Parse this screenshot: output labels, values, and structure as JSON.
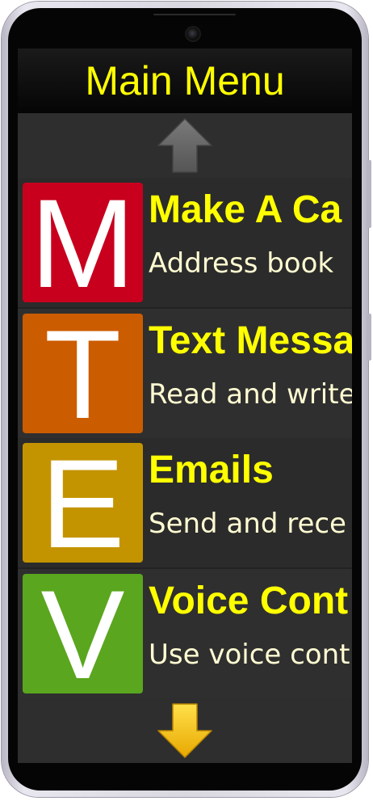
{
  "header": {
    "title": "Main Menu"
  },
  "navigation": {
    "up_icon": "arrow-up-icon",
    "down_icon": "arrow-down-icon",
    "up_color": "#666666",
    "down_color": "#f5c400"
  },
  "menu": {
    "items": [
      {
        "letter": "M",
        "title": "Make A Ca",
        "subtitle": "Address book",
        "color": "#c8001e"
      },
      {
        "letter": "T",
        "title": "Text Messa",
        "subtitle": "Read and write",
        "color": "#cc5c00"
      },
      {
        "letter": "E",
        "title": "Emails",
        "subtitle": "Send and rece",
        "color": "#c49400"
      },
      {
        "letter": "V",
        "title": "Voice Cont",
        "subtitle": "Use voice cont",
        "color": "#5aa61e"
      }
    ]
  },
  "theme": {
    "title_color": "#ffff00",
    "subtitle_color": "#fffbd2",
    "screen_bg": "#222222"
  }
}
